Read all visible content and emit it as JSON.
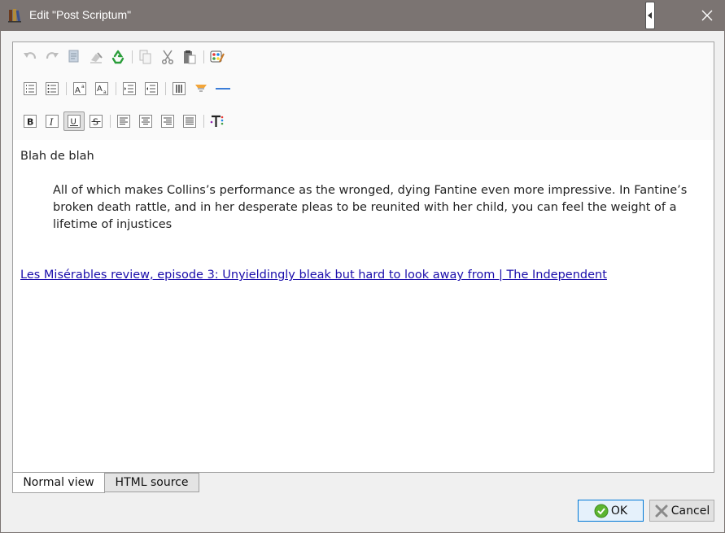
{
  "window": {
    "title": "Edit \"Post Scriptum\""
  },
  "content": {
    "first_line": "Blah de blah",
    "quote": "All of which makes Collins’s performance as the wronged, dying Fantine even more impressive. In Fantine’s broken death rattle, and in her desperate pleas to be reunited with her child, you can feel the weight of a lifetime of injustices",
    "link_text": "Les Misérables review, episode 3: Unyieldingly bleak but hard to look away from | The Independent"
  },
  "tabs": [
    {
      "label": "Normal view",
      "active": true
    },
    {
      "label": "HTML source",
      "active": false
    }
  ],
  "buttons": {
    "ok_label": "OK",
    "cancel_label": "Cancel"
  },
  "colors": {
    "titlebar": "#7b7472",
    "link": "#1a0dab",
    "ok_border": "#0078d7",
    "ok_icon": "#5cb531",
    "recycle_icon": "#2a9d3a"
  },
  "toolbar_icons": {
    "row1": [
      "undo-icon",
      "redo-icon",
      "select-all-icon",
      "remove-format-icon",
      "recycle-icon",
      "copy-icon",
      "cut-icon",
      "paste-icon",
      "color-palette-icon"
    ],
    "row2": [
      "ordered-list-icon",
      "unordered-list-icon",
      "superscript-icon",
      "subscript-icon",
      "indent-icon",
      "outdent-icon",
      "insert-table-icon",
      "insert-image-icon",
      "horizontal-rule-icon"
    ],
    "row3": [
      "bold-icon",
      "italic-icon",
      "underline-icon",
      "strikethrough-icon",
      "align-left-icon",
      "align-center-icon",
      "align-right-icon",
      "align-justify-icon",
      "font-color-icon"
    ]
  }
}
